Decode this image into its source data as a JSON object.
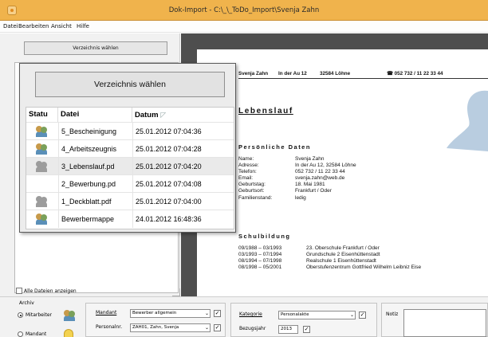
{
  "window": {
    "title": "Dok-Import - C:\\_\\_ToDo_Import\\Svenja Zahn"
  },
  "menu": {
    "items": [
      "Datei",
      "Bearbeiten",
      "Ansicht",
      "Hilfe"
    ]
  },
  "left": {
    "choose_dir_small": "Verzeichnis wählen",
    "show_all_label": "Alle Dateien anzeigen"
  },
  "popup": {
    "choose_dir_big": "Verzeichnis wählen",
    "columns": [
      "Statu",
      "Datei",
      "Datum"
    ],
    "rows": [
      {
        "icon": "people-icon",
        "file": "5_Bescheinigung",
        "date": "25.01.2012 07:04:36",
        "selected": false
      },
      {
        "icon": "people-icon",
        "file": "4_Arbeitszeugnis",
        "date": "25.01.2012 07:04:28",
        "selected": false
      },
      {
        "icon": "people-icon-gray",
        "file": "3_Lebenslauf.pd",
        "date": "25.01.2012 07:04:20",
        "selected": true
      },
      {
        "icon": "",
        "file": "2_Bewerbung.pd",
        "date": "25.01.2012 07:04:08",
        "selected": false
      },
      {
        "icon": "people-icon-gray",
        "file": "1_Deckblatt.pdf",
        "date": "25.01.2012 07:04:00",
        "selected": false
      },
      {
        "icon": "people-icon",
        "file": "Bewerbermappe",
        "date": "24.01.2012 16:48:36",
        "selected": false
      }
    ]
  },
  "document": {
    "header_name": "Svenja Zahn",
    "header_street": "In der Au 12",
    "header_city": "32584 Löhne",
    "header_phone": "☎ 052 732 / 11 22 33 44",
    "title": "Lebenslauf",
    "personal_heading": "Persönliche Daten",
    "personal": [
      {
        "label": "Name:",
        "value": "Svenja Zahn"
      },
      {
        "label": "Adresse:",
        "value": "In der Au 12, 32584 Löhne"
      },
      {
        "label": "Telefon:",
        "value": "052 732 / 11 22 33 44"
      },
      {
        "label": "Email:",
        "value": "svenja.zahn@web.de"
      },
      {
        "label": "Geburtstag:",
        "value": "18. Mai 1981"
      },
      {
        "label": "Geburtsort:",
        "value": "Frankfurt / Oder"
      },
      {
        "label": "Familienstand:",
        "value": "ledig"
      }
    ],
    "school_heading": "Schulbildung",
    "school": [
      {
        "period": "09/1988 – 03/1993",
        "desc": "23. Oberschule Frankfurt / Oder"
      },
      {
        "period": "03/1993 – 07/1994",
        "desc": "Grundschule 2 Eisenhüttenstadt"
      },
      {
        "period": "08/1994 – 07/1998",
        "desc": "Realschule 1 Eisenhüttenstadt"
      },
      {
        "period": "08/1998 – 05/2001",
        "desc": "Oberstufenzentrum Gottfried Wilhelm Leibniz Eise"
      }
    ]
  },
  "bottom": {
    "archiv_label": "Archiv",
    "radio_mitarbeiter": "Mitarbeiter",
    "radio_second": "Mandant",
    "mandant_label": "Mandant",
    "mandant_value": "Bewerber allgemein",
    "personalnr_label": "Personalnr.",
    "personalnr_value": "ZAH01, Zahn, Svenja",
    "kategorie_label": "Kategorie",
    "kategorie_value": "Personalakte",
    "bezugsjahr_label": "Bezugsjahr",
    "bezugsjahr_value": "2013",
    "notiz_label": "Notiz"
  },
  "colors": {
    "titlebar": "#f0b34c",
    "docview_bg": "#4e4e4e"
  }
}
